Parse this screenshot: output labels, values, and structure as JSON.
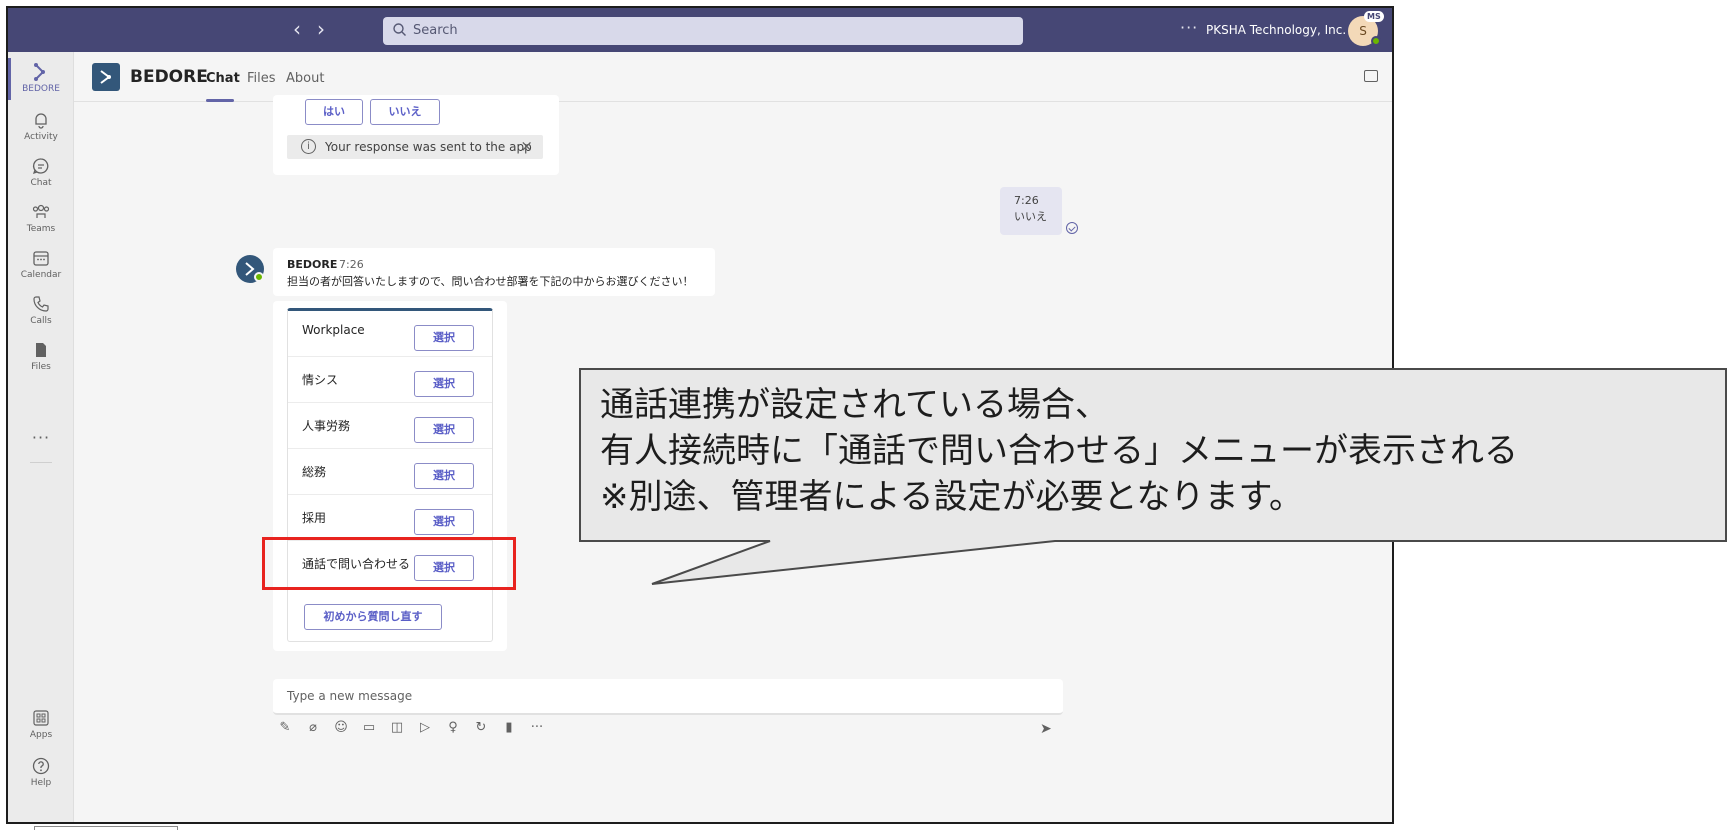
{
  "topbar": {
    "search_placeholder": "Search",
    "more": "···",
    "org_name": "PKSHA Technology, Inc.",
    "avatar_initial": "S",
    "avatar_badge": "MS"
  },
  "rail": {
    "items": [
      {
        "label": "BEDORE"
      },
      {
        "label": "Activity"
      },
      {
        "label": "Chat"
      },
      {
        "label": "Teams"
      },
      {
        "label": "Calendar"
      },
      {
        "label": "Calls"
      },
      {
        "label": "Files"
      },
      {
        "label": "Apps"
      },
      {
        "label": "Help"
      }
    ],
    "more": "···"
  },
  "header": {
    "app_name": "BEDORE",
    "tabs": [
      {
        "label": "Chat"
      },
      {
        "label": "Files"
      },
      {
        "label": "About"
      }
    ]
  },
  "chat": {
    "prev_card": {
      "yes_label": "はい",
      "no_label": "いいえ",
      "sent_note": "Your response was sent to the app"
    },
    "my_message": {
      "time": "7:26",
      "text": "いいえ"
    },
    "bot_message": {
      "name": "BEDORE",
      "time": "7:26",
      "text": "担当の者が回答いたしますので、問い合わせ部署を下記の中からお選びください！"
    },
    "menu": {
      "rows": [
        {
          "label": "Workplace",
          "button": "選択"
        },
        {
          "label": "情シス",
          "button": "選択"
        },
        {
          "label": "人事労務",
          "button": "選択"
        },
        {
          "label": "総務",
          "button": "選択"
        },
        {
          "label": "採用",
          "button": "選択"
        },
        {
          "label": "通話で問い合わせる",
          "button": "選択"
        }
      ],
      "restart_label": "初めから質問し直す"
    },
    "composer_placeholder": "Type a new message"
  },
  "callout": {
    "lines": [
      "通話連携が設定されている場合、",
      "有人接続時に「通話で問い合わせる」メニューが表示される",
      "※別途、管理者による設定が必要となります。"
    ]
  },
  "colors": {
    "topbar": "#464775",
    "accent": "#6264a7",
    "bot_brand": "#33577a",
    "highlight": "#e8231f",
    "callout_fill": "#e8e8e8"
  }
}
